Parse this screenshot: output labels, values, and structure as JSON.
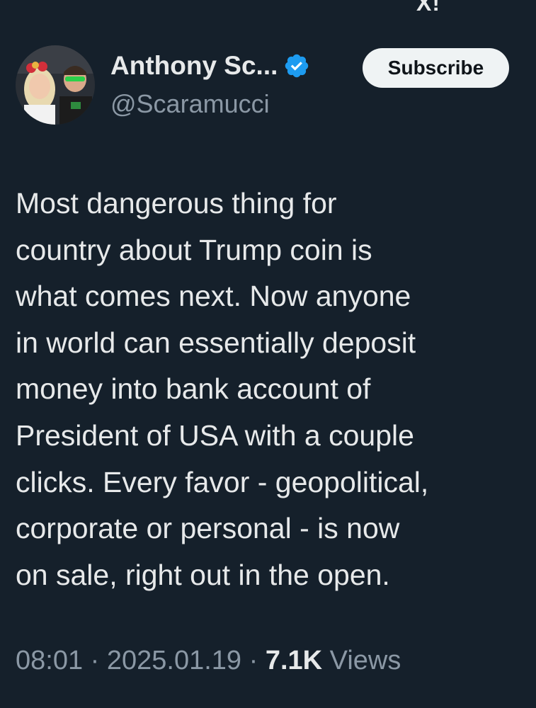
{
  "top_fragment": "X!",
  "author": {
    "display_name": "Anthony Sc...",
    "handle": "@Scaramucci",
    "verified": true,
    "verified_icon": "verified-badge-icon",
    "avatar": "profile-photo"
  },
  "subscribe_label": "Subscribe",
  "tweet": {
    "lines": [
      "Most dangerous thing for",
      "country about Trump coin is",
      "what comes next. Now anyone",
      "in world can essentially deposit",
      "money into bank account of",
      "President of USA with a couple",
      "clicks. Every favor - geopolitical,",
      "corporate or personal - is now",
      "on sale, right out in the open."
    ]
  },
  "meta": {
    "time": "08:01",
    "separator": " · ",
    "date": "2025.01.19",
    "views_count": "7.1K",
    "views_label": " Views"
  },
  "colors": {
    "background": "#15202b",
    "text": "#e7e9ea",
    "secondary": "#8b98a5",
    "verified_blue": "#1d9bf0",
    "button_bg": "#eff3f4"
  }
}
